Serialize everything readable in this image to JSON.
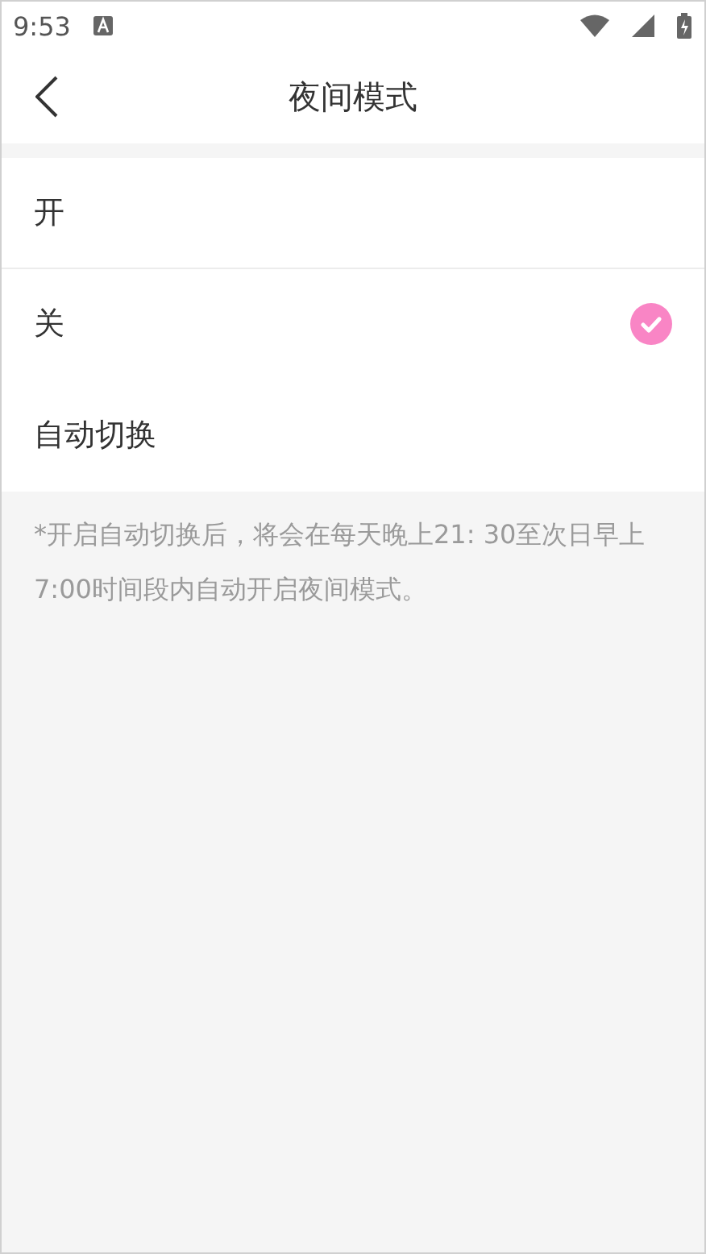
{
  "status_bar": {
    "time": "9:53"
  },
  "header": {
    "title": "夜间模式"
  },
  "options": [
    {
      "label": "开",
      "selected": false
    },
    {
      "label": "关",
      "selected": true
    },
    {
      "label": "自动切换",
      "selected": false
    }
  ],
  "note": "*开启自动切换后，将会在每天晚上21: 30至次日早上7:00时间段内自动开启夜间模式。"
}
